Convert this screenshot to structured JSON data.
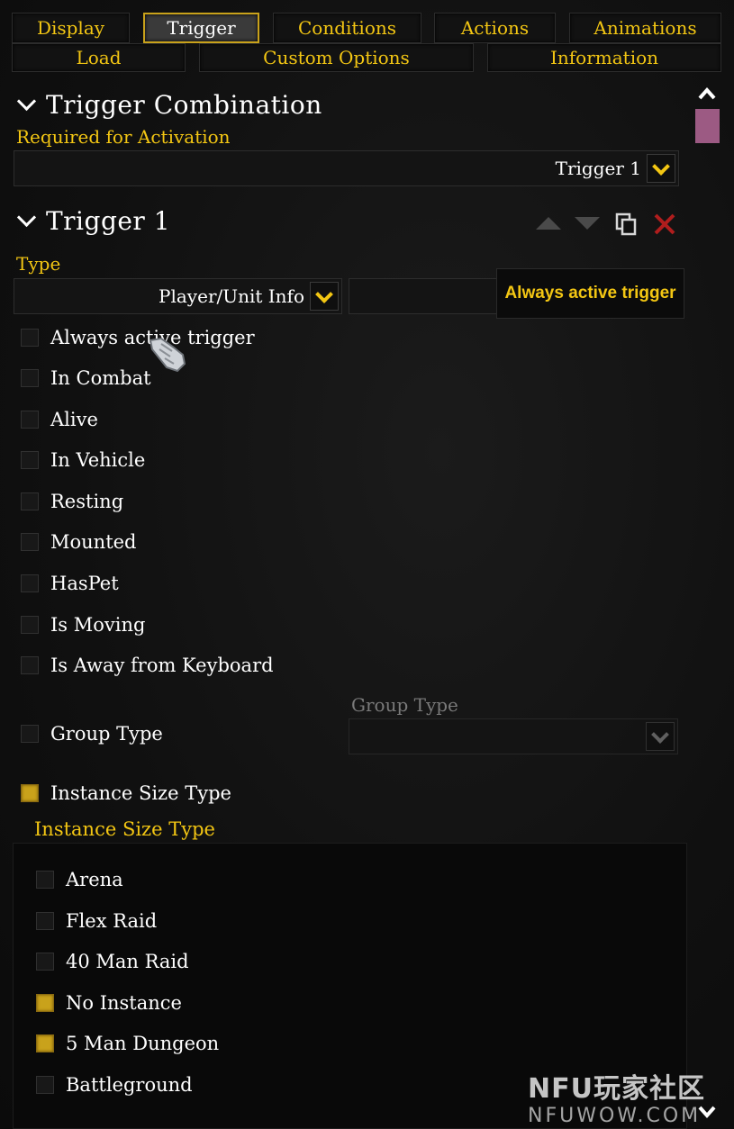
{
  "tabs": {
    "row1": [
      "Display",
      "Trigger",
      "Conditions",
      "Actions",
      "Animations"
    ],
    "row2": [
      "Load",
      "Custom Options",
      "Information"
    ],
    "active": "Trigger"
  },
  "trigger_combination": {
    "title": "Trigger Combination",
    "required_label": "Required for Activation",
    "required_value": "Trigger 1"
  },
  "trigger1": {
    "title": "Trigger 1",
    "type_label": "Type",
    "type_value": "Player/Unit Info",
    "tooltip": "Always active trigger"
  },
  "options": [
    {
      "label": "Always active trigger",
      "checked": false
    },
    {
      "label": "In Combat",
      "checked": false
    },
    {
      "label": "Alive",
      "checked": false
    },
    {
      "label": "In Vehicle",
      "checked": false
    },
    {
      "label": "Resting",
      "checked": false
    },
    {
      "label": "Mounted",
      "checked": false
    },
    {
      "label": "HasPet",
      "checked": false
    },
    {
      "label": "Is Moving",
      "checked": false
    },
    {
      "label": "Is Away from Keyboard",
      "checked": false
    }
  ],
  "group_type": {
    "label": "Group Type",
    "field_label": "Group Type",
    "checked": false
  },
  "instance_size": {
    "label": "Instance Size Type",
    "checked": true,
    "sub_label": "Instance Size Type",
    "items": [
      {
        "label": "Arena",
        "checked": false
      },
      {
        "label": "Flex Raid",
        "checked": false
      },
      {
        "label": "40 Man Raid",
        "checked": false
      },
      {
        "label": "No Instance",
        "checked": true
      },
      {
        "label": "5 Man Dungeon",
        "checked": true
      },
      {
        "label": "Battleground",
        "checked": false
      }
    ]
  },
  "watermark": {
    "top": "NFU玩家社区",
    "bottom": "NFUWOW.COM"
  },
  "colors": {
    "gold": "#f3c613",
    "checked": "#c9a21b",
    "scroll_thumb": "#9c5a83",
    "delete_red": "#b01d1d"
  }
}
